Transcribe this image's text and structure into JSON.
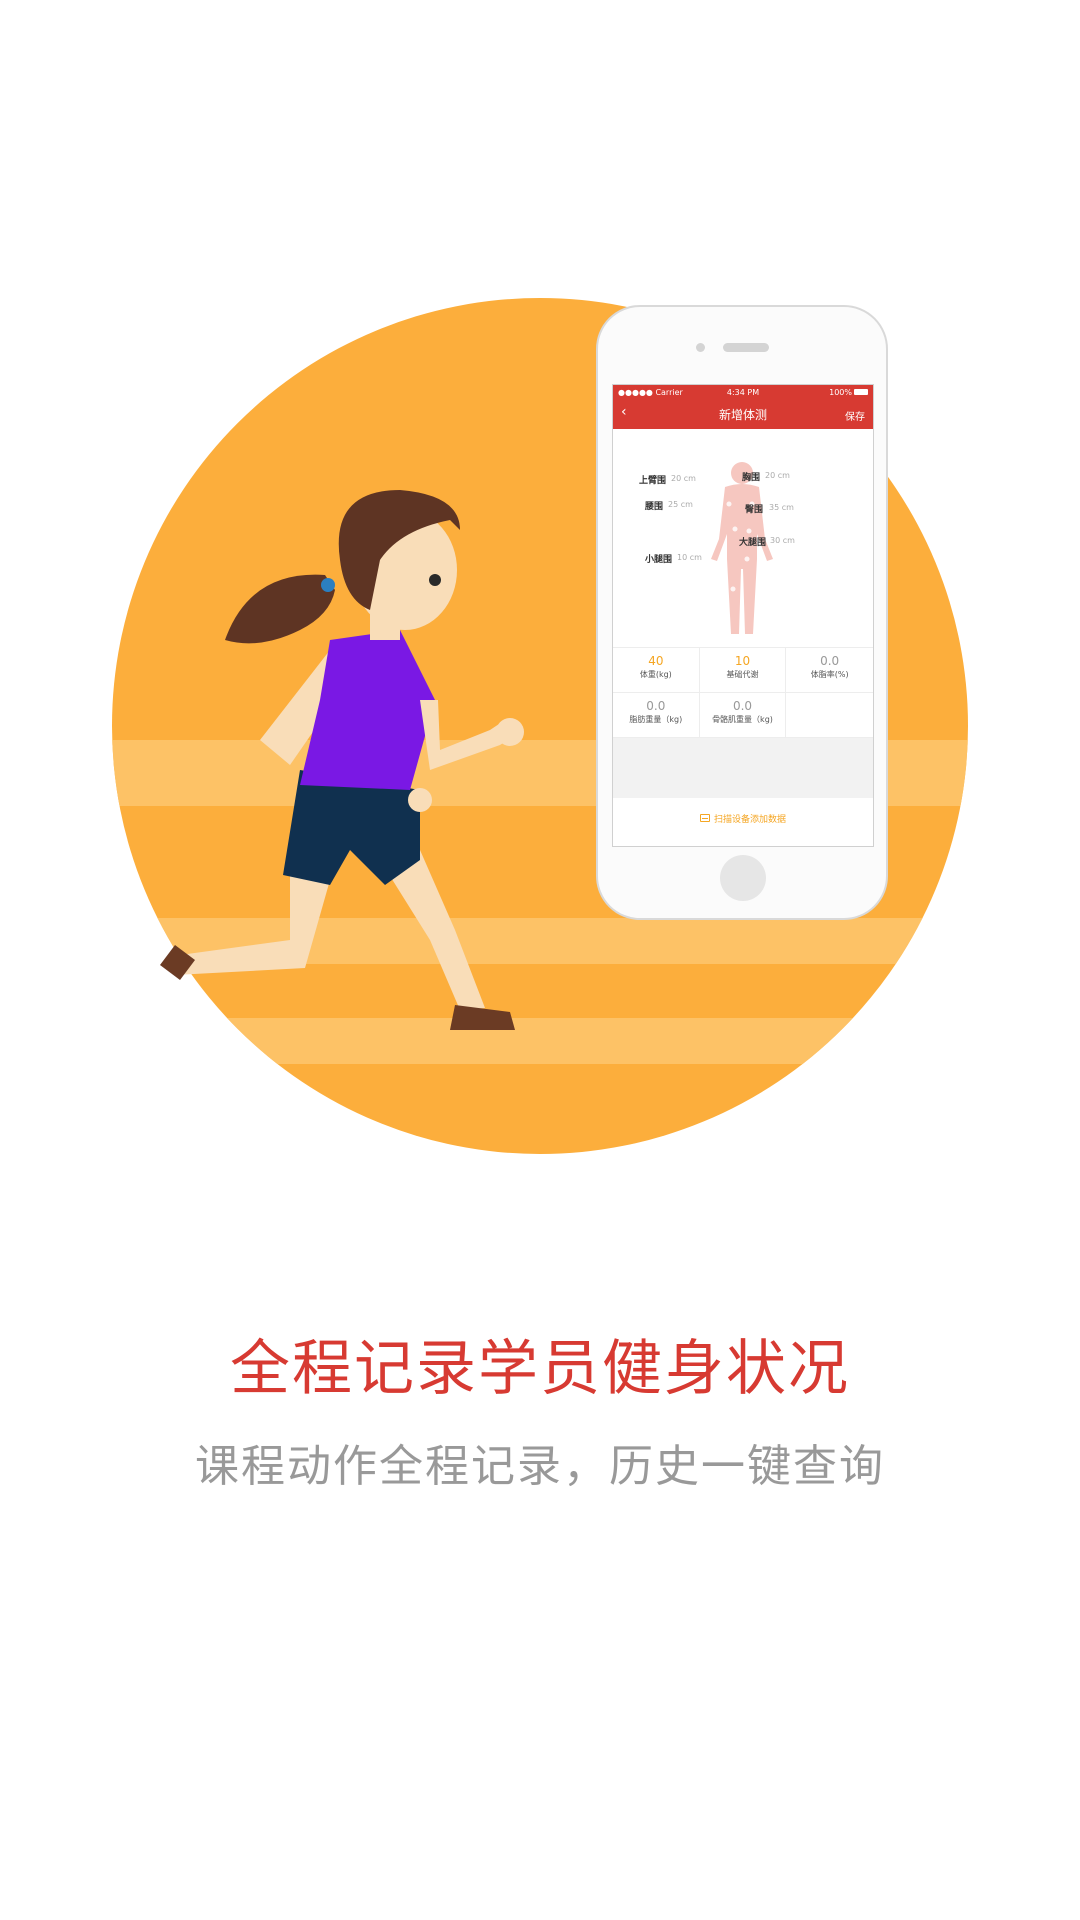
{
  "colors": {
    "accent_red": "#d73a32",
    "orange_bg": "#fcae3c",
    "orange_stripe": "#fdc266",
    "highlight_orange": "#f5a623",
    "subtitle_gray": "#999999"
  },
  "phone": {
    "status_bar": {
      "carrier": "●●●●● Carrier",
      "time": "4:34 PM",
      "battery": "100%"
    },
    "nav": {
      "back_icon": "chevron-left-icon",
      "title": "新增体测",
      "save": "保存"
    },
    "measurements": [
      {
        "label": "上臂围",
        "value": "20 cm"
      },
      {
        "label": "胸围",
        "value": "20 cm"
      },
      {
        "label": "腰围",
        "value": "25 cm"
      },
      {
        "label": "臀围",
        "value": "35 cm"
      },
      {
        "label": "大腿围",
        "value": "30 cm"
      },
      {
        "label": "小腿围",
        "value": "10 cm"
      }
    ],
    "stats": [
      {
        "value": "40",
        "label": "体重(kg)"
      },
      {
        "value": "10",
        "label": "基础代谢"
      },
      {
        "value": "0.0",
        "label": "体脂率(%)"
      },
      {
        "value": "0.0",
        "label": "脂肪重量（kg)"
      },
      {
        "value": "0.0",
        "label": "骨骼肌重量（kg)"
      }
    ],
    "scan_button": {
      "icon": "scan-icon",
      "label": "扫描设备添加数据"
    }
  },
  "headline": "全程记录学员健身状况",
  "subline": "课程动作全程记录，历史一键查询"
}
